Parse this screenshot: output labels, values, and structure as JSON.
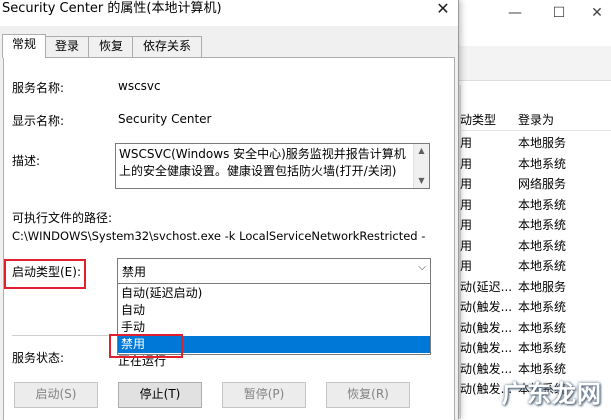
{
  "dialog": {
    "title": "Security Center 的属性(本地计算机)",
    "close_icon": "✕",
    "tabs": [
      {
        "label": "常规",
        "active": true
      },
      {
        "label": "登录"
      },
      {
        "label": "恢复"
      },
      {
        "label": "依存关系"
      }
    ],
    "fields": {
      "service_name_label": "服务名称:",
      "service_name_value": "wscsvc",
      "display_name_label": "显示名称:",
      "display_name_value": "Security Center",
      "description_label": "描述:",
      "description_value": "WSCSVC(Windows 安全中心)服务监视并报告计算机上的安全健康设置。健康设置包括防火墙(打开/关闭)",
      "path_label": "可执行文件的路径:",
      "path_value": "C:\\WINDOWS\\System32\\svchost.exe -k LocalServiceNetworkRestricted -",
      "startup_type_label": "启动类型(E):",
      "startup_type_value": "禁用",
      "service_status_label": "服务状态:",
      "service_status_value": "正在运行"
    },
    "startup_options": [
      {
        "label": "自动(延迟启动)"
      },
      {
        "label": "自动"
      },
      {
        "label": "手动"
      },
      {
        "label": "禁用",
        "selected": true
      }
    ],
    "buttons": {
      "start": "启动(S)",
      "stop": "停止(T)",
      "pause": "暂停(P)",
      "resume": "恢复(R)"
    }
  },
  "background_window": {
    "columns": [
      "动类型",
      "登录为"
    ],
    "rows": [
      {
        "startup": "用",
        "logon": "本地服务"
      },
      {
        "startup": "用",
        "logon": "本地系统"
      },
      {
        "startup": "用",
        "logon": "网络服务"
      },
      {
        "startup": "用",
        "logon": "本地系统"
      },
      {
        "startup": "用",
        "logon": "本地系统"
      },
      {
        "startup": "用",
        "logon": "本地系统"
      },
      {
        "startup": "用",
        "logon": "本地系统"
      },
      {
        "startup": "动(延迟...",
        "logon": "本地服务"
      },
      {
        "startup": "动(触发...",
        "logon": "本地系统"
      },
      {
        "startup": "动(触发...",
        "logon": "本地系统"
      },
      {
        "startup": "动(触发...",
        "logon": "本地系统"
      },
      {
        "startup": "动(触发...",
        "logon": "本地系统"
      },
      {
        "startup": "动(触发...",
        "logon": "本地系统"
      }
    ],
    "minimize_icon": "—",
    "maximize_icon": "☐",
    "close_icon": "✕"
  },
  "watermark": {
    "text": "广东龙网"
  },
  "colors": {
    "highlight": "#0078d7",
    "annotation_red": "#e0202e",
    "row_selected": "#cce4f7"
  }
}
